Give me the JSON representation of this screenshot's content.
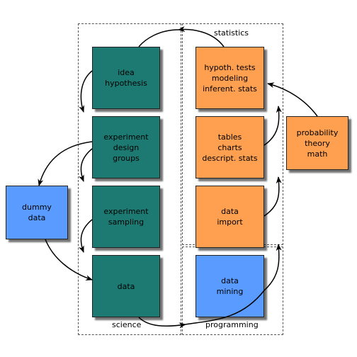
{
  "groups": {
    "science": "science",
    "statistics": "statistics",
    "programming": "programming"
  },
  "boxes": {
    "idea": "idea\nhypothesis",
    "design": "experiment\ndesign\ngroups",
    "sampling": "experiment\nsampling",
    "data": "data",
    "tests": "hypoth. tests\nmodeling\ninferent. stats",
    "tables": "tables\ncharts\ndescript. stats",
    "import": "data\nimport",
    "mining": "data\nmining",
    "probability": "probability\ntheory\nmath",
    "dummy": "dummy\ndata"
  },
  "colors": {
    "science": "#1c7a73",
    "statistics": "#ff9f50",
    "programming": "#5a9bff"
  }
}
